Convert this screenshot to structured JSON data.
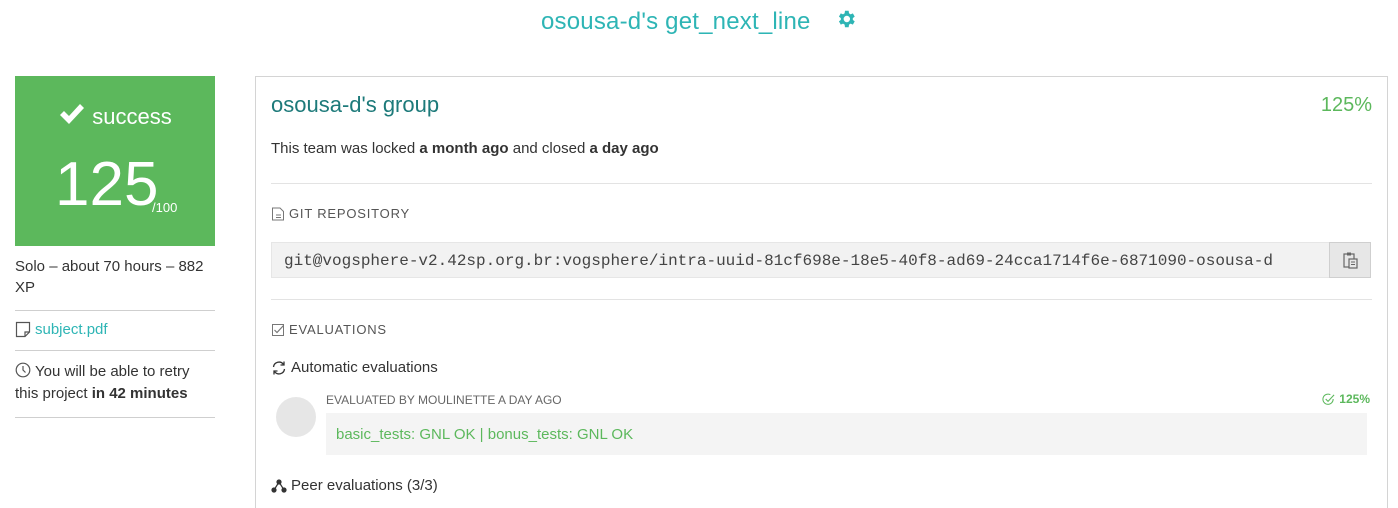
{
  "header": {
    "title": "osousa-d's get_next_line",
    "settings_icon": "gear-icon"
  },
  "status_card": {
    "status": "success",
    "score": "125",
    "max_score": "/100",
    "background_color": "#5cb85c",
    "icon": "check-icon"
  },
  "project_meta": {
    "description": "Solo – about 70 hours – 882 XP",
    "subject_link": "subject.pdf",
    "retry_prefix": "You will be able to retry this project ",
    "retry_time": "in 42 minutes"
  },
  "group": {
    "title": "osousa-d's group",
    "percent": "125%",
    "lock_prefix": "This team was locked ",
    "locked_when": "a month ago",
    "lock_middle": " and closed ",
    "closed_when": "a day ago"
  },
  "repository": {
    "section_label": "GIT REPOSITORY",
    "url": "git@vogsphere-v2.42sp.org.br:vogsphere/intra-uuid-81cf698e-18e5-40f8-ad69-24cca1714f6e-6871090-osousa-d"
  },
  "evaluations": {
    "section_label": "EVALUATIONS",
    "automatic_label": "Automatic evaluations",
    "evaluated_by": "EVALUATED BY MOULINETTE A DAY AGO",
    "score": "125%",
    "result": "basic_tests: GNL OK | bonus_tests: GNL OK",
    "peer_label": "Peer evaluations (3/3)"
  },
  "colors": {
    "accent": "#2eb5b5",
    "success": "#5cb85c",
    "group_title": "#1d7a7a"
  }
}
